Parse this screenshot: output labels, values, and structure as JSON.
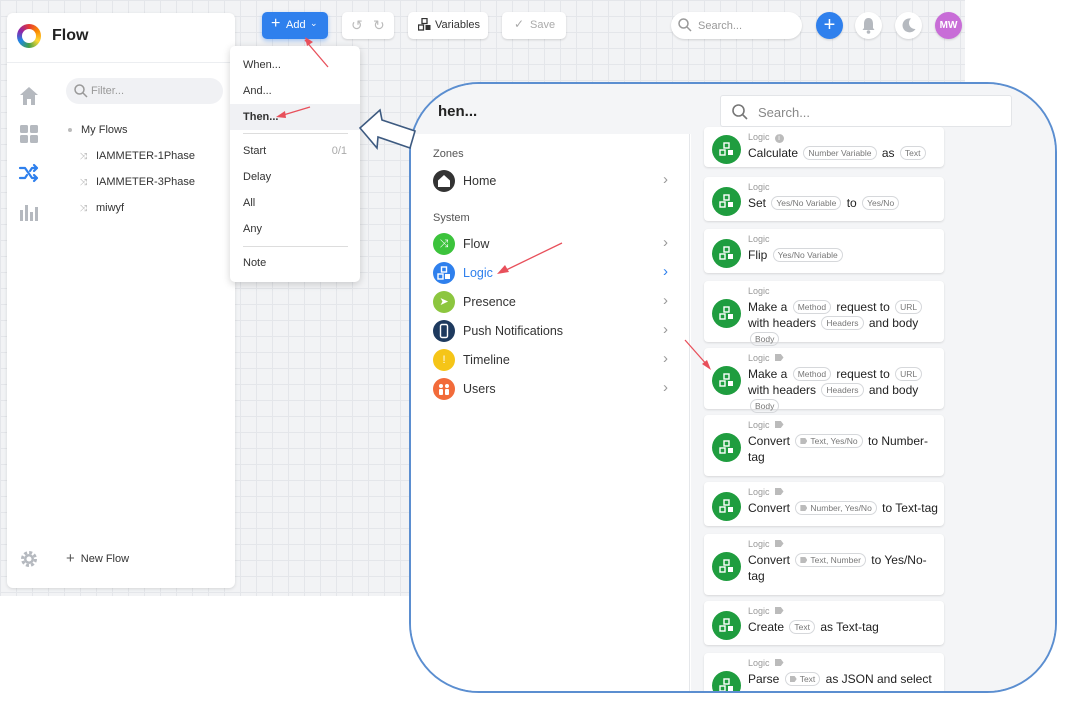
{
  "app": {
    "title": "Flow",
    "colors": {
      "accent": "#2f80ed",
      "logic_green": "#1f9d3f",
      "annotation_red": "#e8505b"
    }
  },
  "toolbar": {
    "add_label": "Add",
    "variables_label": "Variables",
    "save_label": "Save",
    "search_placeholder": "Search...",
    "avatar_initials": "MW"
  },
  "sidebar": {
    "filter_placeholder": "Filter...",
    "root": "My Flows",
    "flows": [
      "IAMMETER-1Phase",
      "IAMMETER-3Phase",
      "miwyf"
    ],
    "new_flow_label": "New Flow",
    "rail_icons": [
      "home-icon",
      "dashboard-icon",
      "flow-icon",
      "insights-icon",
      "settings-icon"
    ]
  },
  "add_menu": {
    "items": [
      {
        "label": "When..."
      },
      {
        "label": "And..."
      },
      {
        "label": "Then...",
        "highlighted": true
      },
      {
        "label": "Start",
        "count": "0/1"
      },
      {
        "label": "Delay"
      },
      {
        "label": "All"
      },
      {
        "label": "Any"
      },
      {
        "label": "Note"
      }
    ]
  },
  "then_panel": {
    "title": "hen...",
    "search_placeholder": "Search...",
    "zones_label": "Zones",
    "system_label": "System",
    "zones": [
      {
        "label": "Home",
        "color": "#333333"
      }
    ],
    "system": [
      {
        "label": "Flow",
        "color": "#3cc33c"
      },
      {
        "label": "Logic",
        "color": "#2f80ed",
        "active": true
      },
      {
        "label": "Presence",
        "color": "#8cc63f"
      },
      {
        "label": "Push Notifications",
        "color": "#1e3a5f"
      },
      {
        "label": "Timeline",
        "color": "#f5c518"
      },
      {
        "label": "Users",
        "color": "#f26b3a"
      }
    ],
    "cards": [
      {
        "category": "Logic",
        "parts": [
          [
            "t",
            "Calculate"
          ],
          [
            "p",
            "Number Variable"
          ],
          [
            "t",
            "as"
          ],
          [
            "p",
            "Text"
          ]
        ]
      },
      {
        "category": "Logic",
        "parts": [
          [
            "t",
            "Set"
          ],
          [
            "p",
            "Yes/No Variable"
          ],
          [
            "t",
            "to"
          ],
          [
            "p",
            "Yes/No"
          ]
        ]
      },
      {
        "category": "Logic",
        "parts": [
          [
            "t",
            "Flip"
          ],
          [
            "p",
            "Yes/No Variable"
          ]
        ]
      },
      {
        "category": "Logic",
        "parts": [
          [
            "t",
            "Make a"
          ],
          [
            "p",
            "Method"
          ],
          [
            "t",
            "request to"
          ],
          [
            "p",
            "URL"
          ],
          [
            "t",
            "with headers"
          ],
          [
            "p",
            "Headers"
          ],
          [
            "t",
            "and body"
          ],
          [
            "p",
            "Body"
          ]
        ]
      },
      {
        "category": "Logic",
        "parts": [
          [
            "t",
            "Make a"
          ],
          [
            "p",
            "Method"
          ],
          [
            "t",
            "request to"
          ],
          [
            "p",
            "URL"
          ],
          [
            "t",
            "with headers"
          ],
          [
            "p",
            "Headers"
          ],
          [
            "t",
            "and body"
          ],
          [
            "p",
            "Body"
          ]
        ]
      },
      {
        "category": "Logic",
        "parts": [
          [
            "t",
            "Convert"
          ],
          [
            "g",
            "Text, Yes/No"
          ],
          [
            "t",
            "to Number-tag"
          ]
        ]
      },
      {
        "category": "Logic",
        "parts": [
          [
            "t",
            "Convert"
          ],
          [
            "g",
            "Number, Yes/No"
          ],
          [
            "t",
            "to Text-tag"
          ]
        ]
      },
      {
        "category": "Logic",
        "parts": [
          [
            "t",
            "Convert"
          ],
          [
            "g",
            "Text, Number"
          ],
          [
            "t",
            "to Yes/No-tag"
          ]
        ]
      },
      {
        "category": "Logic",
        "parts": [
          [
            "t",
            "Create"
          ],
          [
            "p",
            "Text"
          ],
          [
            "t",
            "as Text-tag"
          ]
        ]
      },
      {
        "category": "Logic",
        "parts": [
          [
            "t",
            "Parse"
          ],
          [
            "g",
            "Text"
          ],
          [
            "t",
            "as JSON and select"
          ]
        ]
      }
    ]
  }
}
